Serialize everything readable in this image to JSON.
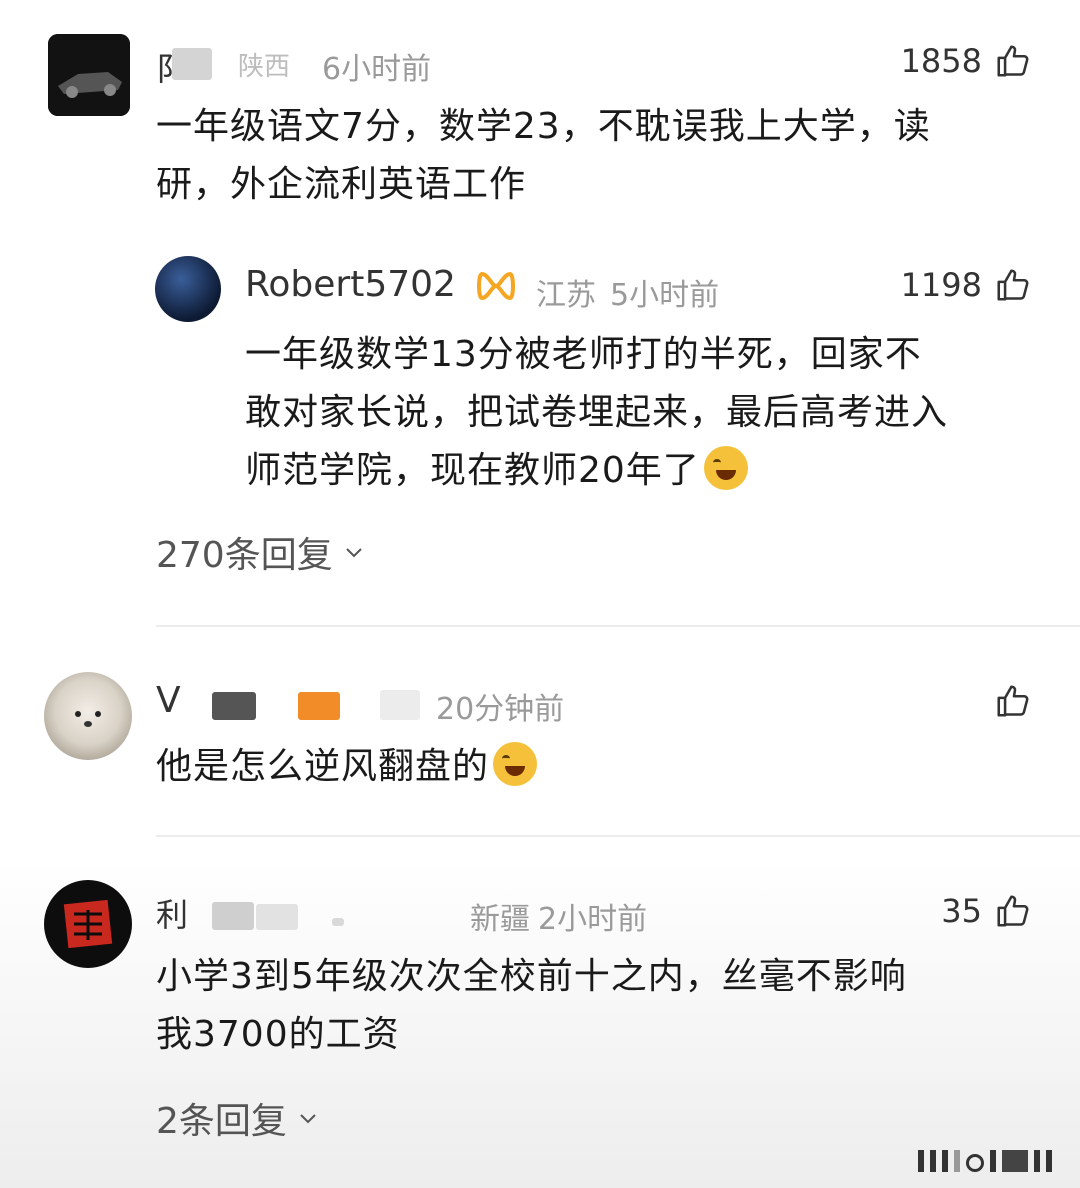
{
  "comments": [
    {
      "name_visible": "阝",
      "location_visible": "陕西",
      "time": "6小时前",
      "likes": "1858",
      "text_line1": "一年级语文7分，数学23，不耽误我上大学，读",
      "text_line2": "研，外企流利英语工作",
      "reply": {
        "name": "Robert5702",
        "location": "江苏",
        "time": "5小时前",
        "likes": "1198",
        "text_line1": "一年级数学13分被老师打的半死，回家不",
        "text_line2": "敢对家长说，把试卷埋起来，最后高考进入",
        "text_line3": "师范学院，现在教师20年了"
      },
      "reply_count": "270条回复"
    },
    {
      "name_visible": "V",
      "time": "20分钟前",
      "likes": "",
      "text_line1": "他是怎么逆风翻盘的"
    },
    {
      "name_visible": "利",
      "location_visible": "新疆",
      "time": "2小时前",
      "likes": "35",
      "text_line1": "小学3到5年级次次全校前十之内，丝毫不影响",
      "text_line2": "我3700的工资",
      "reply_count": "2条回复"
    }
  ],
  "icons": {
    "like": "thumbs-up-icon",
    "chevron": "chevron-down-icon",
    "verified": "vip-badge-icon",
    "emoji": "laugh-cry-emoji"
  },
  "colors": {
    "text": "#1a1a1a",
    "meta": "#9a9a9a",
    "divider": "#ececec",
    "verified_badge": "#f5a623"
  }
}
